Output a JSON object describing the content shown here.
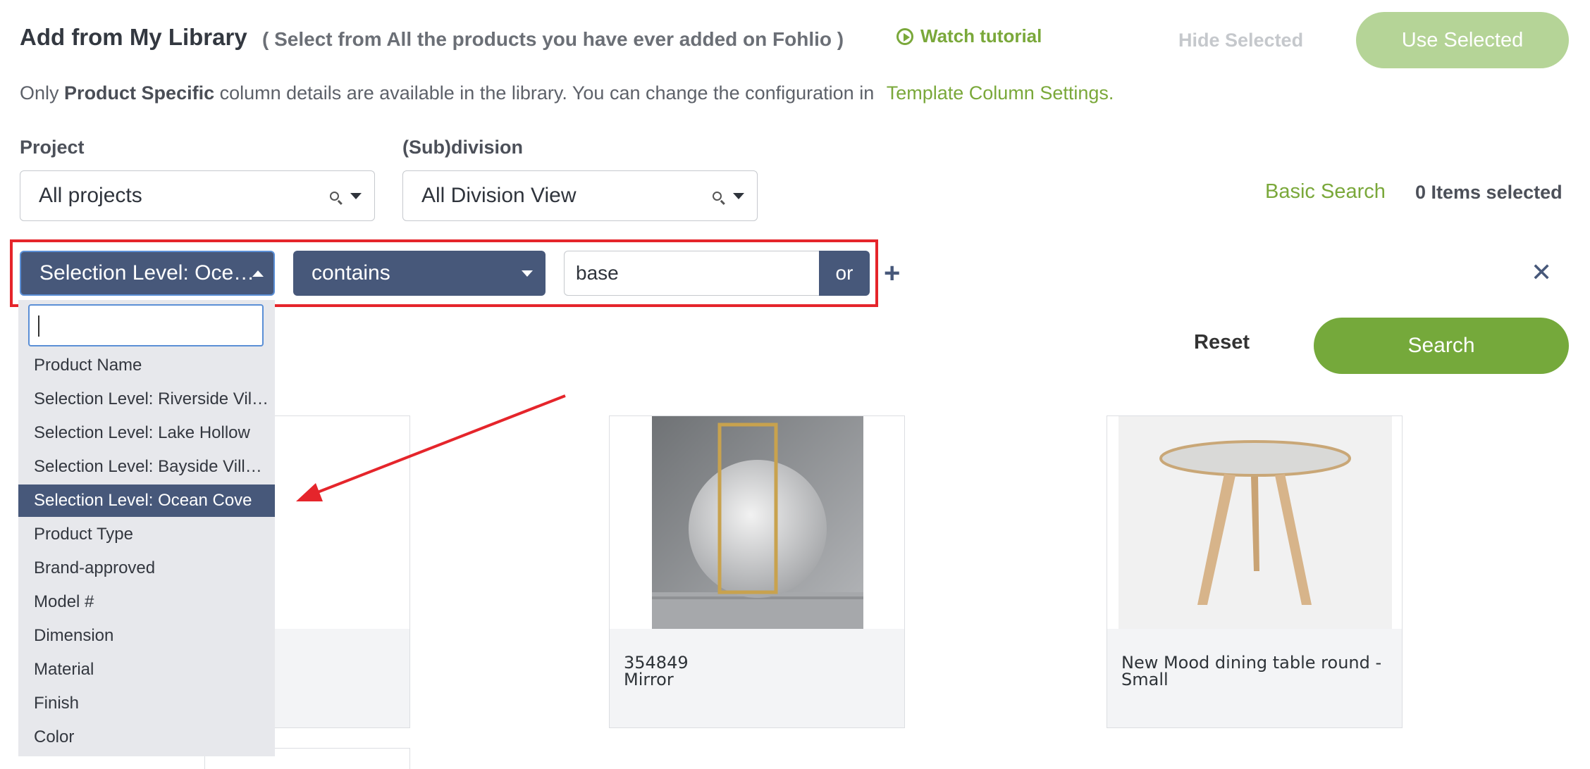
{
  "header": {
    "title": "Add from My Library",
    "subtitle": "( Select from All the products you have ever added on Fohlio )",
    "watch_tutorial": "Watch tutorial",
    "hide_selected": "Hide Selected",
    "use_selected": "Use Selected"
  },
  "info": {
    "prefix": "Only",
    "bold": "Product Specific",
    "middle": "column details are available in the library. You can change the configuration in",
    "link": "Template Column Settings."
  },
  "project": {
    "label": "Project",
    "value": "All projects"
  },
  "subdivision": {
    "label": "(Sub)division",
    "value": "All Division View"
  },
  "basic_search": "Basic Search",
  "items_selected": "0 Items selected",
  "filter": {
    "field": "Selection Level: Oce…",
    "operator": "contains",
    "value": "base",
    "or_label": "or",
    "add_label": "+",
    "remove_label": "✕"
  },
  "actions": {
    "reset": "Reset",
    "search": "Search"
  },
  "dropdown": {
    "items": [
      "Product Name",
      "Selection Level: Riverside Vil…",
      "Selection Level: Lake Hollow",
      "Selection Level: Bayside Vill…",
      "Selection Level: Ocean Cove",
      "Product Type",
      "Brand-approved",
      "Model #",
      "Dimension",
      "Material",
      "Finish",
      "Color"
    ],
    "active_index": 4
  },
  "products": [
    {
      "caption": ""
    },
    {
      "caption": "354849\nMirror"
    },
    {
      "caption": "New Mood dining table round -\nSmall"
    }
  ],
  "colors": {
    "accent_green": "#75a93b",
    "navy": "#47587a",
    "annotation_red": "#e5252b"
  }
}
